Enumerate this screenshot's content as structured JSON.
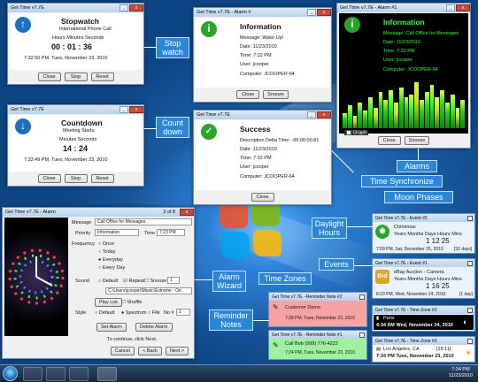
{
  "window_title": "Get Time v7.7E",
  "stopwatch": {
    "title": "Get Time v7.7E",
    "heading": "Stopwatch",
    "subtitle": "International Phone Call",
    "labels": "Hours    Minutes    Seconds",
    "time": "00 : 01 : 36",
    "timestamp": "7:32:50 PM, Tues, November 23, 2010",
    "btn_close": "Close",
    "btn_stop": "Stop",
    "btn_reset": "Reset"
  },
  "countdown": {
    "title": "Get Time v7.7E",
    "heading": "Countdown",
    "subtitle": "Meeting Starts",
    "labels": "Minutes   Seconds",
    "time": "14 : 24",
    "timestamp": "7:33:49 PM, Tues, November 23, 2010",
    "btn_close": "Close",
    "btn_stop": "Stop",
    "btn_reset": "Reset"
  },
  "alarm_info": {
    "title": "Get Time v7.7E - Alarm #",
    "heading": "Information",
    "message": "Message: Wake Up!",
    "date": "Date: 11/23/2010",
    "time": "Time: 7:32 PM",
    "user": "User: jcooper",
    "computer": "Computer: JCOOPER-64",
    "btn_close": "Close",
    "btn_snooze": "Snooze"
  },
  "success": {
    "title": "Get Time v7.7E",
    "heading": "Success",
    "delta": "Description Delta Time: -00:00:00.81",
    "date": "Date: 11/23/2010",
    "time": "Time: 7:32 PM",
    "user": "User: jcooper",
    "computer": "Computer: JCOOPER-64",
    "btn_close": "Close"
  },
  "alarm_graph": {
    "title": "Get Time v7.7E - Alarm #1",
    "heading": "Information",
    "message": "Message: Call Office for Messages",
    "date": "Date: 11/23/2010",
    "time": "Time: 7:32 PM",
    "user": "User: jcooper",
    "computer": "Computer: JCOOPER-64",
    "graph_label": "Graph",
    "btn_close": "Close",
    "btn_snooze": "Snooze",
    "bars": [
      0.3,
      0.45,
      0.25,
      0.5,
      0.35,
      0.6,
      0.4,
      0.7,
      0.55,
      0.75,
      0.5,
      0.8,
      0.6,
      0.65,
      0.9,
      0.55,
      0.7,
      0.85,
      0.6,
      0.75,
      0.5,
      0.65,
      0.4,
      0.55
    ]
  },
  "wizard": {
    "title": "Get Time v7.7E - Alarm",
    "page": "3 of 8",
    "message_label": "Message",
    "message_value": "Call Office for Messages",
    "priority_label": "Priority",
    "priority_value": "Information",
    "time_label": "Time",
    "time_value": "7:23 PM",
    "frequency_label": "Frequency",
    "opt_once": "Once",
    "opt_today": "Today",
    "opt_everyday": "Everyday",
    "opt_everyday2": "Every Day",
    "sound_label": "Sound",
    "opt_default": "Default",
    "opt_repeat": "Repeat",
    "opt_snooze": "Snooze",
    "snooze_value": "1",
    "mp3_path": "C:\\Users\\jcooper\\Music\\Extreme - Ori",
    "btn_play": "Play List",
    "opt_shuffle": "Shuffle",
    "style_label": "Style",
    "opt_spectrum": "Spectrum",
    "opt_file": "File",
    "no_label": "No #",
    "no_value": "1",
    "btn_set": "Set Alarm",
    "btn_delete": "Delete Alarm",
    "hint": "To continue, click Next.",
    "btn_cancel": "Cancel",
    "btn_back": "< Back",
    "btn_next": "Next >"
  },
  "event2": {
    "title": "Get Time v7.7E - Event #2",
    "name": "Christmas",
    "headers": "Years  Months  Days  Hours  Mins",
    "values": "1    12    25",
    "date": "7:59 PM, Sat, December 25, 2010",
    "days": "[32 days]"
  },
  "event1": {
    "title": "Get Time v7.7E - Event #1",
    "name": "eBay Auction - Camera",
    "headers": "Years  Months  Days  Hours  Mins",
    "values": "1    16    25",
    "date": "8:23 PM, Wed, November 24, 2010",
    "days": "[1 day]"
  },
  "reminder2": {
    "title": "Get Time v7.7E - Reminder Note #2",
    "text": "Customer Demo",
    "date": "7:28 PM, Tues, November 23, 2010"
  },
  "reminder1": {
    "title": "Get Time v7.7E - Reminder Note #1",
    "text": "Call Bob (999) 776-4222",
    "date": "7:24 PM, Tues, November 23, 2010"
  },
  "zone2": {
    "title": "Get Time v7.7E - Time Zone #2",
    "city": "Paris",
    "time": "4:34 AM  Wed, November 24, 2010"
  },
  "zone3": {
    "title": "Get Time v7.7E - Time Zone #3",
    "city": "Los Angeles, CA",
    "offset": "[18:11]",
    "time": "7:34 PM  Tues, November 23, 2010"
  },
  "callouts": {
    "stopwatch": "Stop watch",
    "countdown": "Count down",
    "alarms": "Alarms",
    "time_sync": "Time Synchronize",
    "moon": "Moon Phases",
    "daylight": "Daylight Hours",
    "events": "Events",
    "time_zones": "Time Zones",
    "alarm_wizard": "Alarm Wizard",
    "reminder": "Reminder Notes"
  },
  "taskbar": {
    "time": "7:34 PM",
    "date": "11/23/2010"
  },
  "colors": {
    "callout": "#2b86d6",
    "graph_bg": "#000000",
    "graph_text": "#2cff2c",
    "reminder2_bg": "#f7a3a3",
    "reminder1_bg": "#9ff09f"
  }
}
